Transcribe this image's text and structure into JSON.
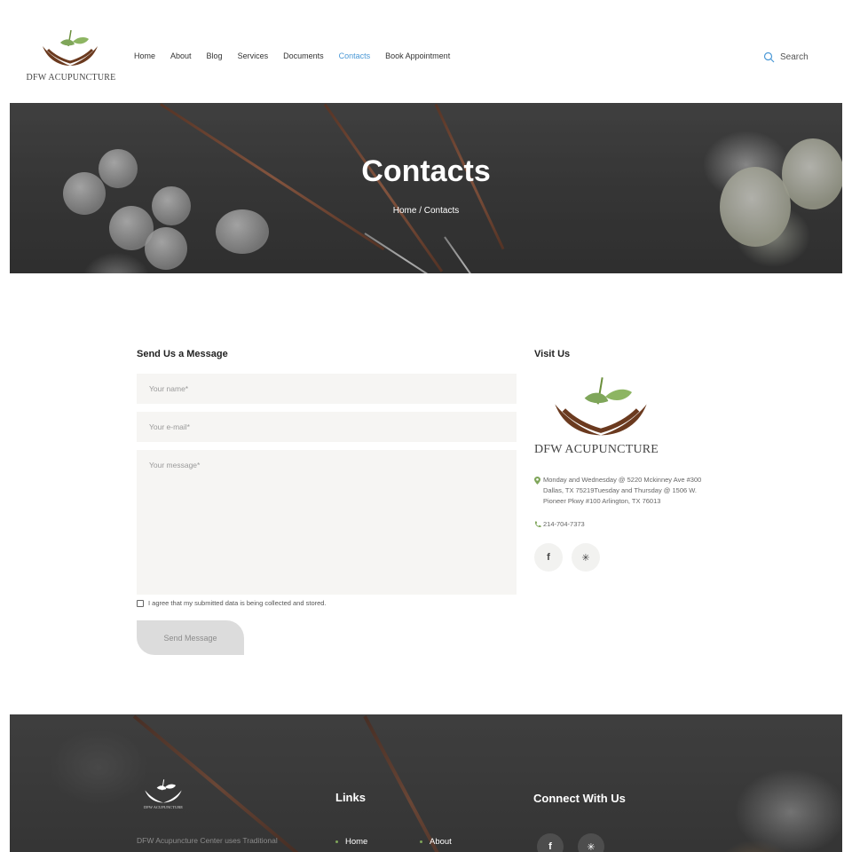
{
  "brand": {
    "name": "DFW ACUPUNCTURE",
    "colors": {
      "accent": "#4a98d6",
      "leaf": "#7fa65a",
      "hands": "#6b3a1f"
    }
  },
  "nav": {
    "items": [
      {
        "label": "Home"
      },
      {
        "label": "About"
      },
      {
        "label": "Blog"
      },
      {
        "label": "Services"
      },
      {
        "label": "Documents"
      },
      {
        "label": "Contacts",
        "active": true
      },
      {
        "label": "Book Appointment"
      }
    ],
    "search_label": "Search",
    "search_icon": "search-icon"
  },
  "hero": {
    "title": "Contacts",
    "breadcrumb": "Home / Contacts"
  },
  "form": {
    "title": "Send Us a Message",
    "name_placeholder": "Your name*",
    "email_placeholder": "Your e-mail*",
    "message_placeholder": "Your message*",
    "agree_label": "I agree that my submitted data is being collected and stored.",
    "send_label": "Send Message"
  },
  "visit": {
    "title": "Visit Us",
    "logo_text": "DFW ACUPUNCTURE",
    "address": "Monday and Wednesday @ 5220 Mckinney Ave #300 Dallas, TX 75219Tuesday and Thursday @ 1506 W. Pioneer Pkwy #100 Arlington, TX 76013",
    "phone": "214-704-7373",
    "social": [
      {
        "icon": "facebook-icon",
        "glyph": "f"
      },
      {
        "icon": "yelp-icon",
        "glyph": "✳"
      }
    ]
  },
  "footer": {
    "logo_text": "DFW ACUPUNCTURE",
    "description": "DFW Acupuncture Center uses Traditional",
    "links_title": "Links",
    "links": [
      "Home",
      "About"
    ],
    "connect_title": "Connect With Us",
    "social": [
      {
        "icon": "facebook-icon",
        "glyph": "f"
      },
      {
        "icon": "yelp-icon",
        "glyph": "✳"
      }
    ]
  }
}
